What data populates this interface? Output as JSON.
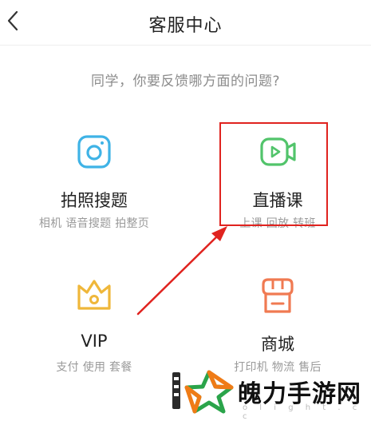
{
  "header": {
    "title": "客服中心",
    "back_icon": "chevron-left-icon"
  },
  "prompt": "同学，你要反馈哪方面的问题?",
  "cards": [
    {
      "label": "拍照搜题",
      "sub": "相机 语音搜题 拍整页",
      "icon": "camera-icon",
      "color": "#3fb3e6"
    },
    {
      "label": "直播课",
      "sub": "上课 回放 转班",
      "icon": "video-camera-icon",
      "color": "#52c46b",
      "highlighted": true
    },
    {
      "label": "VIP",
      "sub": "支付 使用 套餐",
      "icon": "crown-icon",
      "color": "#efb73a"
    },
    {
      "label": "商城",
      "sub": "打印机 物流 售后",
      "icon": "shop-icon",
      "color": "#f07a52"
    }
  ],
  "annotation": {
    "color": "#e0231f"
  },
  "watermark": {
    "text": "魄力手游网",
    "url": "o l i g h t . c c"
  }
}
